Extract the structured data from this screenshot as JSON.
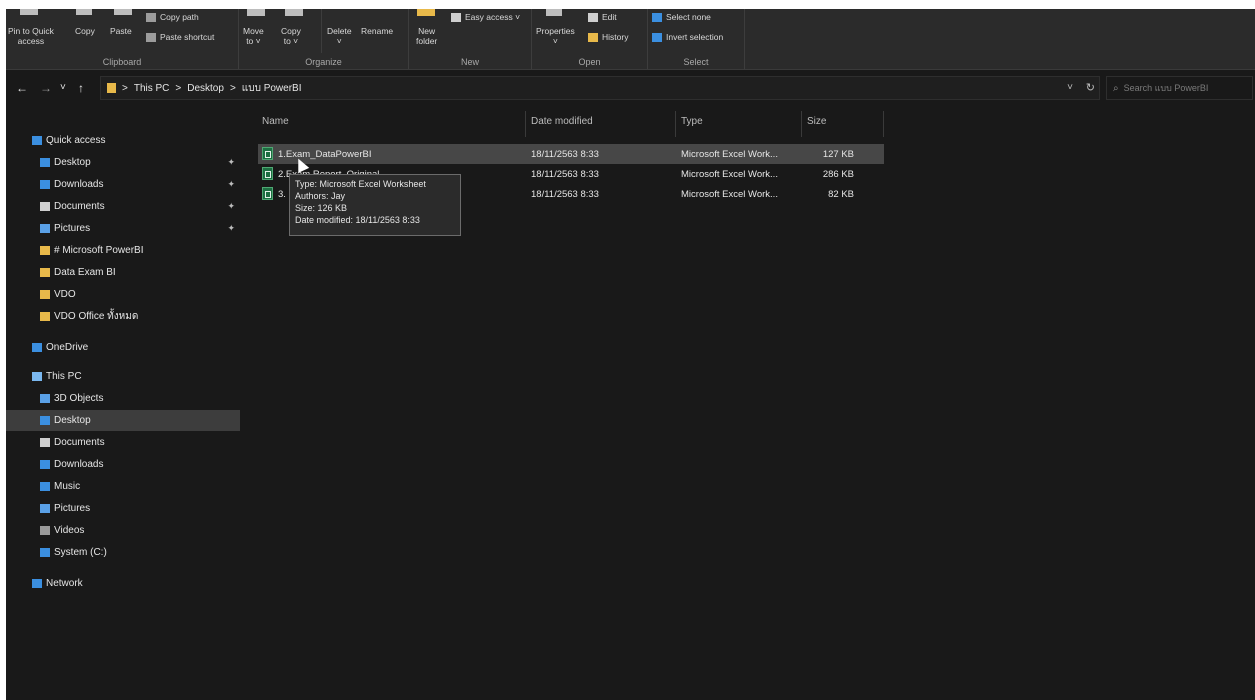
{
  "ribbon": {
    "clipboard": {
      "pin_label_1": "Pin to Quick",
      "pin_label_2": "access",
      "copy_label": "Copy",
      "paste_label": "Paste",
      "copy_path_label": "Copy path",
      "paste_shortcut_label": "Paste shortcut",
      "group_label": "Clipboard"
    },
    "organize": {
      "move_label_1": "Move",
      "move_label_2": "to ˅",
      "copy_label_1": "Copy",
      "copy_label_2": "to ˅",
      "delete_label": "Delete",
      "rename_label": "Rename",
      "group_label": "Organize"
    },
    "new": {
      "new_folder_label_1": "New",
      "new_folder_label_2": "folder",
      "easy_access_label": "Easy access ˅",
      "group_label": "New"
    },
    "open": {
      "properties_label": "Properties",
      "edit_label": "Edit",
      "history_label": "History",
      "group_label": "Open"
    },
    "select": {
      "select_none_label": "Select none",
      "invert_selection_label": "Invert selection",
      "group_label": "Select"
    }
  },
  "address": {
    "back": "←",
    "forward": "→",
    "recent": "˅",
    "up": "↑",
    "path": [
      ">",
      "This PC",
      ">",
      "Desktop",
      ">",
      "แบบ PowerBI"
    ],
    "dropdown": "˅",
    "refresh": "↻",
    "search_placeholder": "Search แบบ PowerBI"
  },
  "nav": {
    "items": [
      {
        "label": "Quick access",
        "icon": "star-icon",
        "color": "#3b8fe0"
      },
      {
        "label": "Desktop",
        "icon": "desktop-icon",
        "color": "#3b8fe0",
        "pin": "✦"
      },
      {
        "label": "Downloads",
        "icon": "download-icon",
        "color": "#3b8fe0",
        "pin": "✦"
      },
      {
        "label": "Documents",
        "icon": "document-icon",
        "color": "#cfcfcf",
        "pin": "✦"
      },
      {
        "label": "Pictures",
        "icon": "pictures-icon",
        "color": "#5aa0e6",
        "pin": "✦"
      },
      {
        "label": "# Microsoft PowerBI",
        "icon": "folder-icon",
        "color": "#e8b94a"
      },
      {
        "label": "Data Exam BI",
        "icon": "folder-icon",
        "color": "#e8b94a"
      },
      {
        "label": "VDO",
        "icon": "folder-icon",
        "color": "#e8b94a"
      },
      {
        "label": "VDO Office ทั้งหมด",
        "icon": "folder-icon",
        "color": "#e8b94a"
      },
      {
        "label": "OneDrive",
        "icon": "cloud-icon",
        "color": "#3b8fe0"
      },
      {
        "label": "This PC",
        "icon": "computer-icon",
        "color": "#7ab8f0"
      },
      {
        "label": "3D Objects",
        "icon": "cube-icon",
        "color": "#5aa0e6"
      },
      {
        "label": "Desktop",
        "icon": "desktop-icon",
        "color": "#3b8fe0"
      },
      {
        "label": "Documents",
        "icon": "document-icon",
        "color": "#cfcfcf"
      },
      {
        "label": "Downloads",
        "icon": "download-icon",
        "color": "#3b8fe0"
      },
      {
        "label": "Music",
        "icon": "music-icon",
        "color": "#3b8fe0"
      },
      {
        "label": "Pictures",
        "icon": "pictures-icon",
        "color": "#5aa0e6"
      },
      {
        "label": "Videos",
        "icon": "video-icon",
        "color": "#9a9a9a"
      },
      {
        "label": "System (C:)",
        "icon": "drive-icon",
        "color": "#3b8fe0"
      },
      {
        "label": "Network",
        "icon": "network-icon",
        "color": "#3b8fe0"
      }
    ]
  },
  "columns": {
    "name": "Name",
    "date": "Date modified",
    "type": "Type",
    "size": "Size"
  },
  "files": [
    {
      "name": "1.Exam_DataPowerBI",
      "date": "18/11/2563 8:33",
      "type": "Microsoft Excel Work...",
      "size": "127 KB"
    },
    {
      "name": "2.Exam Report_Original",
      "date": "18/11/2563 8:33",
      "type": "Microsoft Excel Work...",
      "size": "286 KB"
    },
    {
      "name": "3.",
      "date": "18/11/2563 8:33",
      "type": "Microsoft Excel Work...",
      "size": "82 KB"
    }
  ],
  "tooltip": {
    "type": "Type: Microsoft Excel Worksheet",
    "authors": "Authors: Jay",
    "size": "Size: 126 KB",
    "date": "Date modified: 18/11/2563 8:33"
  }
}
